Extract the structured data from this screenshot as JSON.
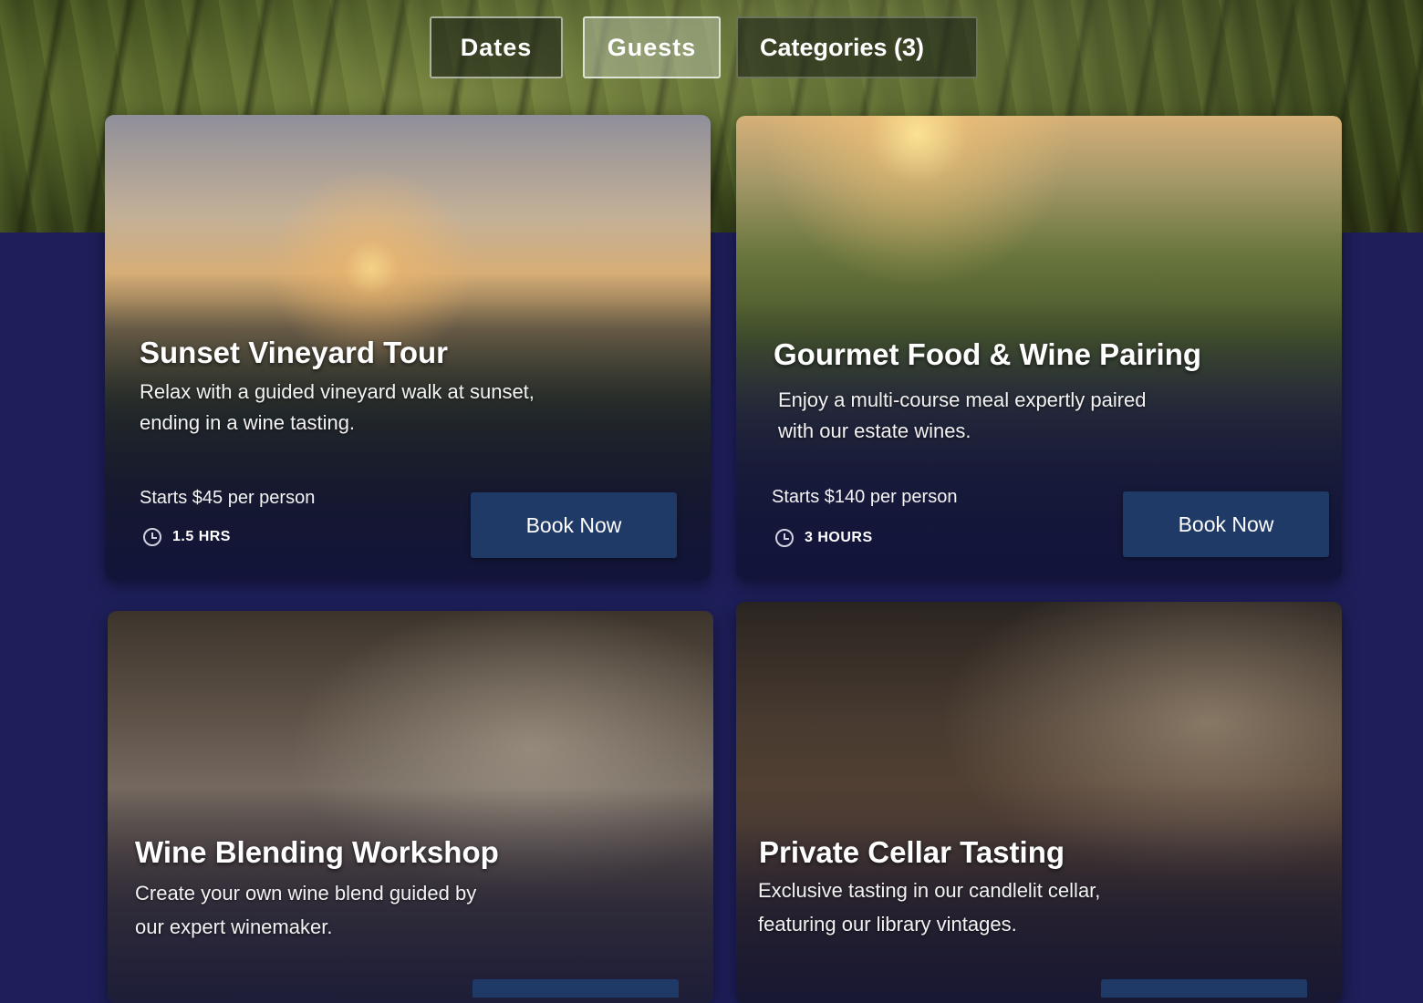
{
  "filters": {
    "dates_label": "Dates",
    "guests_label": "Guests",
    "categories_label": "Categories (3)"
  },
  "experiences": [
    {
      "title": "Sunset Vineyard Tour",
      "description_line1": "Relax with a guided vineyard walk at sunset,",
      "description_line2": "ending in a wine tasting.",
      "price": "Starts $45 per person",
      "duration": "1.5 HRS",
      "book_label": "Book Now"
    },
    {
      "title": "Gourmet Food & Wine Pairing",
      "description_line1": "Enjoy a multi-course meal expertly paired",
      "description_line2": "with our estate wines.",
      "price": "Starts $140 per person",
      "duration": "3 HOURS",
      "book_label": "Book Now"
    },
    {
      "title": "Wine Blending Workshop",
      "description_line1": "Create your own wine blend guided by",
      "description_line2": "our expert winemaker."
    },
    {
      "title": "Private Cellar Tasting",
      "description_line1": "Exclusive tasting in our candlelit cellar,",
      "description_line2": "featuring our library vintages."
    }
  ],
  "colors": {
    "page_background": "#1e1f5a",
    "button_background": "#1f3a66"
  },
  "icons": {
    "duration": "clock-icon"
  }
}
